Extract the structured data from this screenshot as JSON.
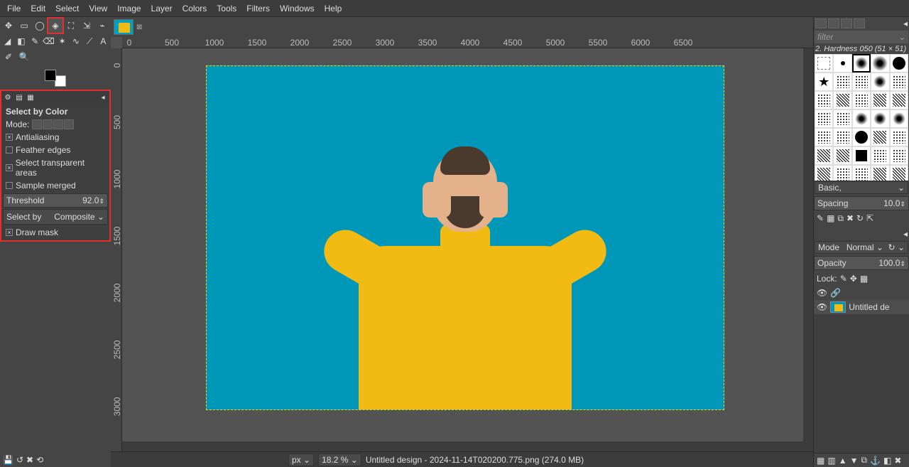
{
  "menu": [
    "File",
    "Edit",
    "Select",
    "View",
    "Image",
    "Layer",
    "Colors",
    "Tools",
    "Filters",
    "Windows",
    "Help"
  ],
  "tool_options": {
    "title": "Select by Color",
    "mode_label": "Mode:",
    "antialiasing": "Antialiasing",
    "feather": "Feather edges",
    "transparent": "Select transparent areas",
    "sample_merged": "Sample merged",
    "threshold_label": "Threshold",
    "threshold_value": "92.0",
    "selectby_label": "Select by",
    "selectby_value": "Composite",
    "draw_mask": "Draw mask"
  },
  "brushes": {
    "filter_placeholder": "filter",
    "info": "2. Hardness 050 (51 × 51)",
    "preset": "Basic,",
    "spacing_label": "Spacing",
    "spacing_value": "10.0"
  },
  "layers": {
    "mode_label": "Mode",
    "mode_value": "Normal",
    "opacity_label": "Opacity",
    "opacity_value": "100.0",
    "lock_label": "Lock:",
    "layer_name": "Untitled de"
  },
  "status": {
    "unit": "px",
    "zoom": "18.2 %",
    "filename": "Untitled design - 2024-11-14T020200.775.png (274.0 MB)"
  },
  "ruler_h": [
    "0",
    "500",
    "1000",
    "1500",
    "2000",
    "2500",
    "3000",
    "3500",
    "4000",
    "4500",
    "5000",
    "5500",
    "6000",
    "6500"
  ],
  "ruler_v": [
    "0",
    "500",
    "1000",
    "1500",
    "2000",
    "2500",
    "3000"
  ]
}
